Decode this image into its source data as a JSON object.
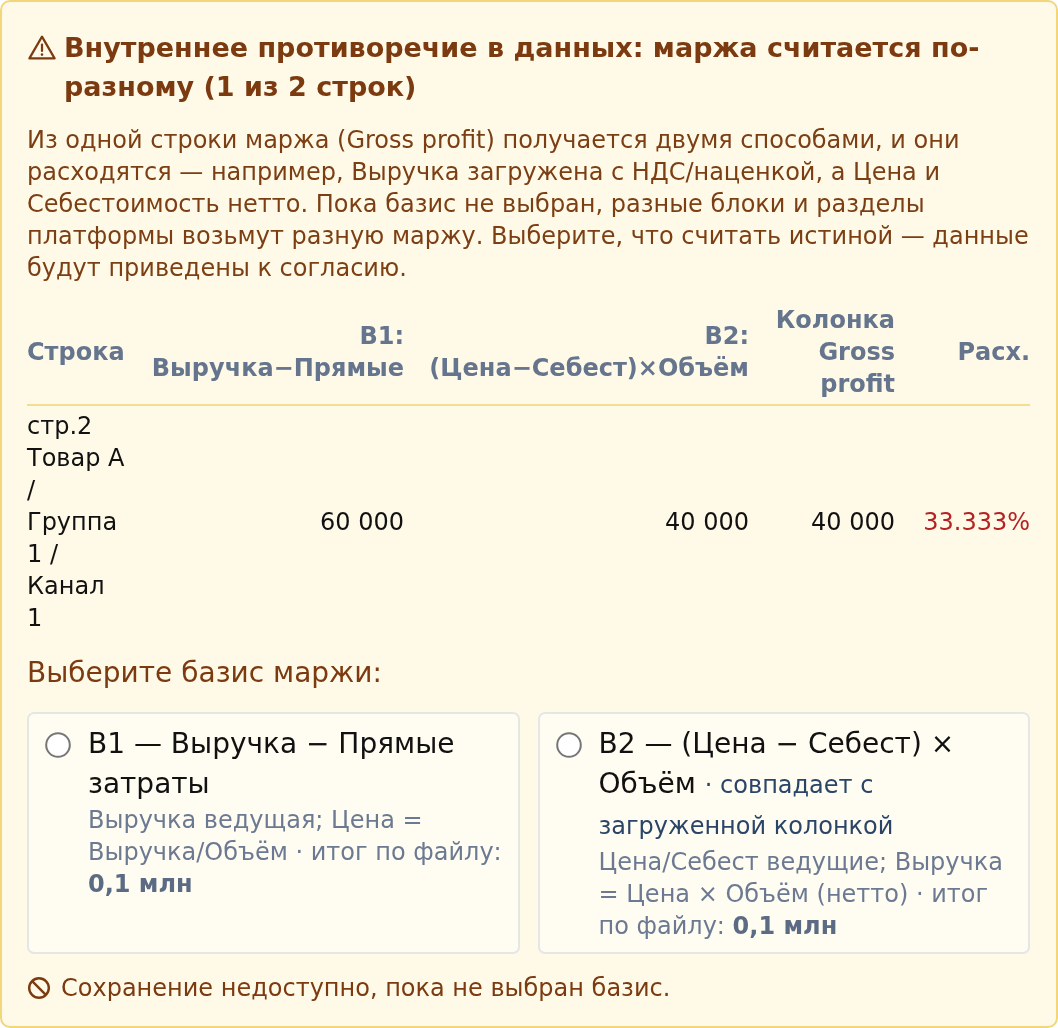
{
  "alert": {
    "title": "Внутреннее противоречие в данных: маржа считается по-разному (1 из 2 строк)",
    "description": "Из одной строки маржа (Gross profit) получается двумя способами, и они расходятся — например, Выручка загружена с НДС/наценкой, а Цена и Себестоимость нетто. Пока базис не выбран, разные блоки и разделы платформы возьмут разную маржу. Выберите, что считать истиной — данные будут приведены к согласию."
  },
  "table": {
    "columns": [
      "Строка",
      "B1: Выручка−Прямые",
      "B2: (Цена−Себест)×Объём",
      "Колонка Gross profit",
      "Расх."
    ],
    "rows": [
      {
        "cells": [
          "стр.2 Товар A / Группа 1 / Канал 1",
          "60 000",
          "40 000",
          "40 000",
          "33.333%"
        ],
        "mismatch": true
      }
    ]
  },
  "choice": {
    "heading": "Выберите базис маржи:",
    "options": [
      {
        "title": "B1 — Выручка − Прямые затраты",
        "description": "Выручка ведущая; Цена = Выручка/Объём · итог по файлу: **0,1 млн**",
        "selected": false
      },
      {
        "title": "B2 — (Цена − Себест) × Объём",
        "note": "· совпадает с загруженной колонкой",
        "description": "Цена/Себест ведущие; Выручка = Цена × Объём (нетто) · итог по файлу: **0,1 млн**",
        "selected": false
      }
    ]
  },
  "footer": {
    "text": "Сохранение недоступно, пока не выбран базис."
  }
}
